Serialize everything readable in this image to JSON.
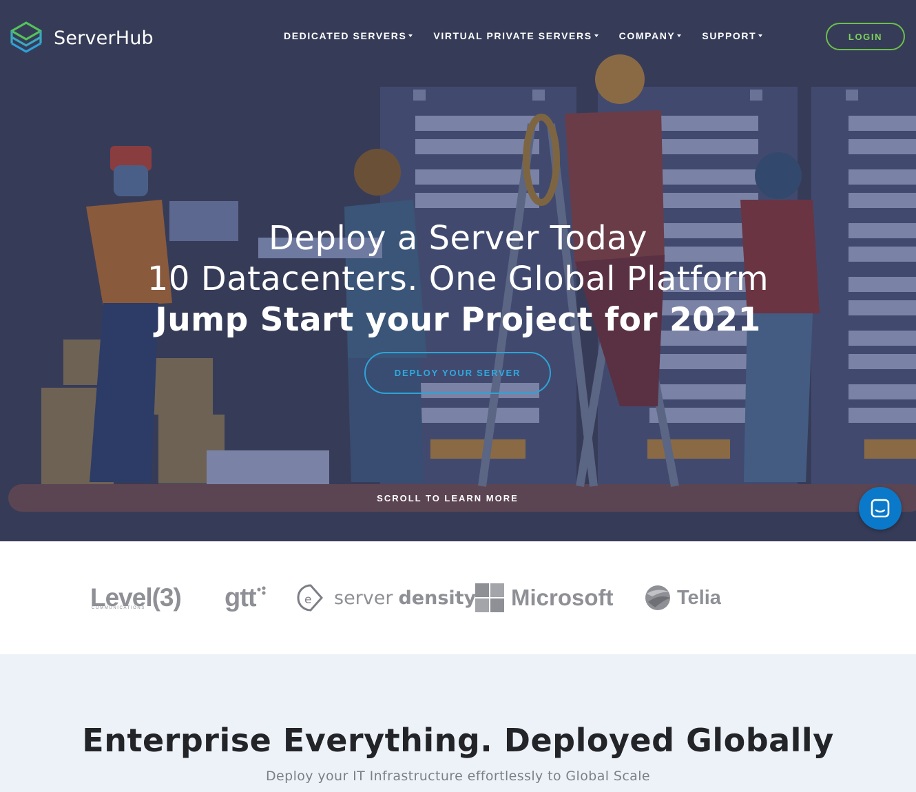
{
  "brand": {
    "name": "ServerHub"
  },
  "nav": {
    "items": [
      {
        "label": "DEDICATED SERVERS"
      },
      {
        "label": "VIRTUAL PRIVATE SERVERS"
      },
      {
        "label": "COMPANY"
      },
      {
        "label": "SUPPORT"
      }
    ],
    "login_label": "LOGIN"
  },
  "hero": {
    "line1": "Deploy a Server Today",
    "line2": "10 Datacenters. One Global Platform",
    "line3": "Jump Start your Project for 2021",
    "cta_label": "DEPLOY YOUR SERVER",
    "scroll_label": "SCROLL TO LEARN MORE"
  },
  "chat": {
    "icon": "chat-icon"
  },
  "partners": {
    "level3": {
      "name": "Level(3)",
      "sub": "COMMUNICATIONS"
    },
    "gtt": {
      "name": "gtt"
    },
    "serverdensity": {
      "name_light": "server",
      "name_bold": "density"
    },
    "microsoft": {
      "name": "Microsoft"
    },
    "telia": {
      "name": "Telia"
    }
  },
  "enterprise": {
    "title": "Enterprise Everything. Deployed Globally",
    "subtitle": "Deploy your IT Infrastructure effortlessly to Global Scale"
  },
  "colors": {
    "hero_bg": "#363c58",
    "login_accent": "#6cc04a",
    "cta_accent": "#2ea3d8",
    "chat_bg": "#0b79c9",
    "section_bg": "#edf2f9"
  }
}
